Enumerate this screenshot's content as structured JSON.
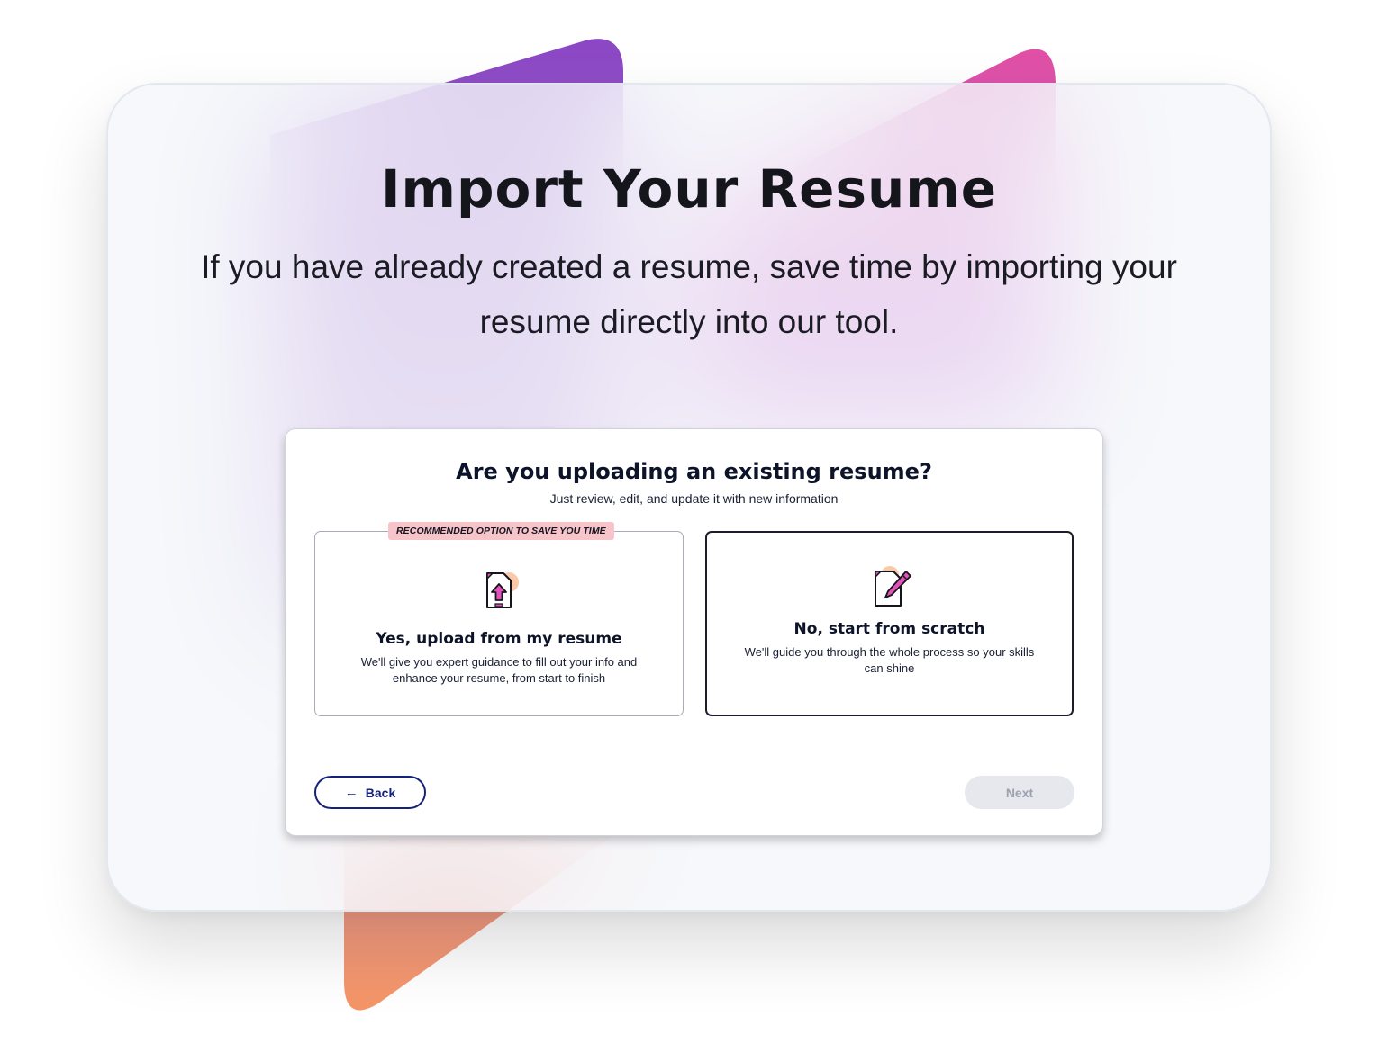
{
  "hero": {
    "title": "Import Your Resume",
    "subtitle": "If you have already created a resume, save time by importing your resume directly into our tool."
  },
  "dialog": {
    "title": "Are you uploading an existing resume?",
    "subtitle": "Just review, edit, and update it with new information",
    "options": [
      {
        "badge": "RECOMMENDED OPTION TO SAVE YOU TIME",
        "icon": "upload-document-icon",
        "title": "Yes, upload from my resume",
        "description": "We'll give you expert guidance to fill out your info and enhance your resume, from start to finish"
      },
      {
        "icon": "edit-document-icon",
        "title": "No, start from scratch",
        "description": "We'll guide you through the whole process so your skills can shine"
      }
    ],
    "back_label": "Back",
    "back_icon": "arrow-left-icon",
    "next_label": "Next"
  },
  "colors": {
    "navy": "#16217a",
    "accent_pink": "#e052b8",
    "badge_bg": "#f6c4c9",
    "disabled_bg": "#e6e8ee",
    "disabled_text": "#9ba1af"
  }
}
